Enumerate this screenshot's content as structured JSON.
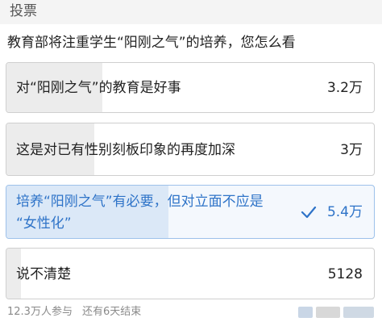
{
  "header": {
    "title": "投票"
  },
  "question": "教育部将注重学生“阳刚之气”的培养，您怎么看",
  "options": [
    {
      "label": "对“阳刚之气”的教育是好事",
      "count": "3.2万",
      "selected": false,
      "fraction": 0.26
    },
    {
      "label": "这是对已有性别刻板印象的再度加深",
      "count": "3万",
      "selected": false,
      "fraction": 0.24
    },
    {
      "label_line1": "培养“阳刚之气”有必要，但对立面不应是",
      "label_line2": "“女性化”",
      "count": "5.4万",
      "selected": true,
      "fraction": 0.44
    },
    {
      "label": "说不清楚",
      "count": "5128",
      "selected": false,
      "fraction": 0.04
    }
  ],
  "footer": {
    "participants": "12.3万人参与",
    "remaining": "还有6天结束"
  },
  "colors": {
    "accent": "#2e73c8",
    "selected_fill": "#dbe8f7",
    "fill": "#ececec",
    "border": "#cfcfcf"
  },
  "icons": {
    "selected_mark": "checkmark-icon"
  }
}
